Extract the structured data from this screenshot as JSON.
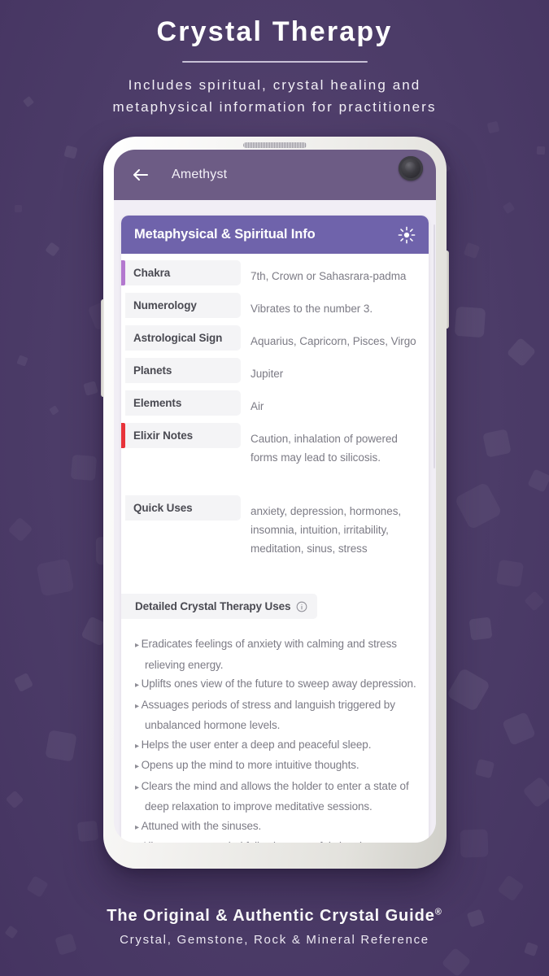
{
  "promo": {
    "title": "Crystal Therapy",
    "subtitle_line1": "Includes spiritual, crystal healing and",
    "subtitle_line2": "metaphysical information for practitioners",
    "footer_main": "The Original & Authentic Crystal Guide",
    "footer_main_sup": "®",
    "footer_sub": "Crystal, Gemstone, Rock & Mineral Reference"
  },
  "colors": {
    "background": "#4d3d69",
    "app_bar": "#6d5c85",
    "section_header": "#6f63ab",
    "chakra_accent": "#b378cf",
    "elixir_accent": "#e8333a",
    "label_chip": "#f4f4f6",
    "value_text": "#7c7b85"
  },
  "app": {
    "app_bar": {
      "back_icon": "back-arrow-icon",
      "title": "Amethyst",
      "camera_icon": "camera-lens-icon"
    },
    "section": {
      "title": "Metaphysical & Spiritual Info",
      "icon": "sun-brightness-icon"
    },
    "properties": [
      {
        "label": "Chakra",
        "value": "7th, Crown or Sahasrara-padma",
        "accent": "#b378cf",
        "spaced": false
      },
      {
        "label": "Numerology",
        "value": "Vibrates to the number 3.",
        "accent": "",
        "spaced": false
      },
      {
        "label": "Astrological Sign",
        "value": "Aquarius, Capricorn, Pisces, Virgo",
        "accent": "",
        "spaced": false
      },
      {
        "label": "Planets",
        "value": "Jupiter",
        "accent": "",
        "spaced": false
      },
      {
        "label": "Elements",
        "value": "Air",
        "accent": "",
        "spaced": false
      },
      {
        "label": "Elixir Notes",
        "value": "Caution, inhalation of powered forms may lead to silicosis.",
        "accent": "#e8333a",
        "spaced": false
      },
      {
        "label": "Quick Uses",
        "value": "anxiety, depression, hormones, insomnia, intuition, irritability, meditation, sinus, stress",
        "accent": "",
        "spaced": true
      }
    ],
    "detailed": {
      "title": "Detailed Crystal Therapy Uses",
      "icon": "info-circle-icon",
      "bullet_glyph": "▸",
      "items": [
        "Eradicates feelings of anxiety with calming and stress relieving energy.",
        "Uplifts ones view of the future to sweep away depression.",
        "Assuages periods of stress and languish triggered by unbalanced hormone levels.",
        "Helps the user enter a deep and peaceful sleep.",
        "Opens up the mind to more intuitive thoughts.",
        "Clears the mind and allows the holder to enter a state of deep relaxation to improve meditative sessions.",
        "Attuned with the sinuses.",
        "Allows one to unwind following stressful situations."
      ]
    }
  }
}
